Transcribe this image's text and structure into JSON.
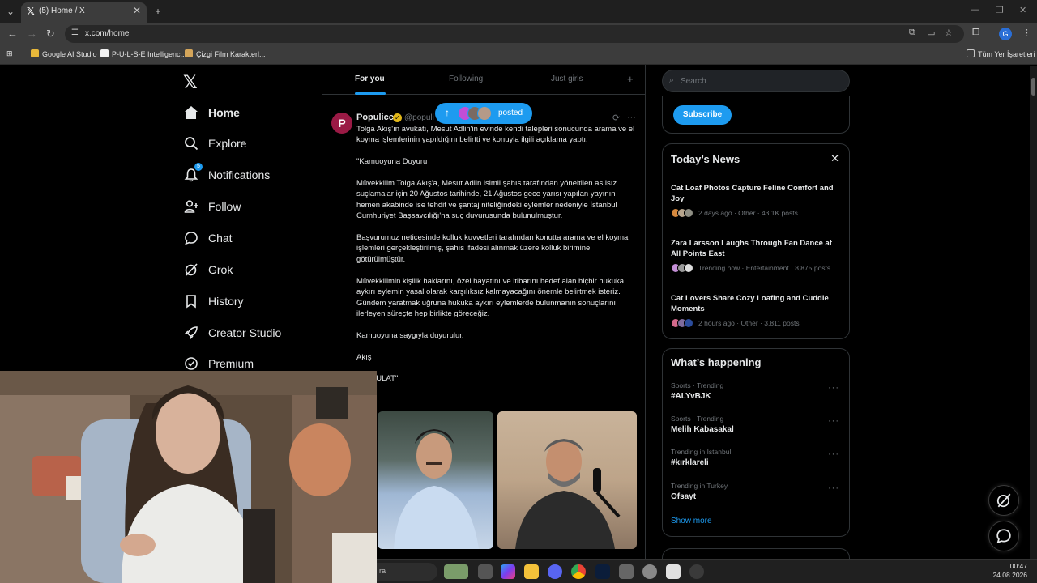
{
  "browser": {
    "tab_title": "(5) Home / X",
    "url": "x.com/home",
    "profile_initial": "G",
    "bookmarks": [
      "Google AI Studio",
      "P-U-L-S-E Intelligenc...",
      "Çizgi Film Karakterl..."
    ],
    "all_bookmarks": "Tüm Yer İşaretleri"
  },
  "sidebar": {
    "items": [
      {
        "label": "Home",
        "icon": "home-icon"
      },
      {
        "label": "Explore",
        "icon": "search-icon"
      },
      {
        "label": "Notifications",
        "icon": "bell-icon",
        "badge": "5"
      },
      {
        "label": "Follow",
        "icon": "person-add-icon"
      },
      {
        "label": "Chat",
        "icon": "chat-bubble-icon"
      },
      {
        "label": "Grok",
        "icon": "grok-icon"
      },
      {
        "label": "History",
        "icon": "bookmark-icon"
      },
      {
        "label": "Creator Studio",
        "icon": "rocket-icon"
      },
      {
        "label": "Premium",
        "icon": "check-circle-icon"
      }
    ]
  },
  "feed": {
    "tabs": [
      "For you",
      "Following",
      "Just girls"
    ],
    "new_posts": {
      "label": "posted"
    },
    "post": {
      "author": "Populicc",
      "handle": "@populi",
      "text": "Tolga Akış'ın avukatı, Mesut Adlin'in evinde kendi talepleri sonucunda arama ve el koyma işlemlerinin yapıldığını belirtti ve konuyla ilgili açıklama yaptı:\n\n\"Kamuoyuna Duyuru\n\nMüvekkilim Tolga Akış'a, Mesut Adlin isimli şahıs tarafından yöneltilen asılsız suçlamalar için 20 Ağustos tarihinde, 21 Ağustos gece yarısı yapılan yayının hemen akabinde ise tehdit ve şantaj niteliğindeki eylemler nedeniyle İstanbul Cumhuriyet Başsavcılığı'na suç duyurusunda bulunulmuştur.\n\nBaşvurumuz neticesinde kolluk kuvvetleri tarafından konutta arama ve el koyma işlemleri gerçekleştirilmiş, şahıs ifadesi alınmak üzere kolluk birimine götürülmüştür.\n\nMüvekkilimin kişilik haklarını, özel hayatını ve itibarını hedef alan hiçbir hukuka aykırı eylemin yasal olarak karşılıksız kalmayacağını önemle belirtmek isteriz. Gündem yaratmak uğruna hukuka aykırı eylemlerde bulunmanın sonuçlarını ilerleyen süreçte hep birlikte göreceğiz.\n\nKamuoyuna saygıyla duyurulur.\n\nAkış\n\naya PULAT\""
    }
  },
  "right": {
    "search_placeholder": "Search",
    "subscribe_label": "Subscribe",
    "news_title": "Today’s News",
    "news": [
      {
        "title": "Cat Loaf Photos Capture Feline Comfort and Joy",
        "meta": "2 days ago · Other · 43.1K posts"
      },
      {
        "title": "Zara Larsson Laughs Through Fan Dance at All Points East",
        "meta": "Trending now · Entertainment · 8,875 posts"
      },
      {
        "title": "Cat Lovers Share Cozy Loafing and Cuddle Moments",
        "meta": "2 hours ago · Other · 3,811 posts"
      }
    ],
    "happening_title": "What’s happening",
    "trends": [
      {
        "category": "Sports · Trending",
        "name": "#ALYvBJK"
      },
      {
        "category": "Sports · Trending",
        "name": "Melih Kabasakal"
      },
      {
        "category": "Trending in Istanbul",
        "name": "#kırklareli"
      },
      {
        "category": "Trending in Turkey",
        "name": "Ofsayt"
      }
    ],
    "show_more": "Show more"
  },
  "taskbar": {
    "search_text": "ra",
    "time": "00:47",
    "date": "24.08.2026"
  },
  "colors": {
    "accent": "#1d9bf0",
    "background": "#000000",
    "border": "#2f3336",
    "muted": "#71767b"
  }
}
